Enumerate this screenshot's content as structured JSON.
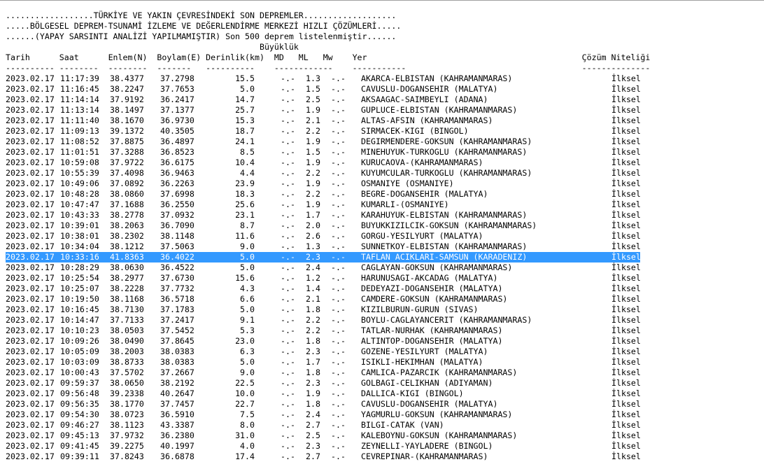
{
  "header": {
    "line1": "..................TÜRKİYE VE YAKIN ÇEVRESİNDEKİ SON DEPREMLER...................",
    "line2": ".....BÖLGESEL DEPREM-TSUNAMİ İZLEME VE DEĞERLENDİRME MERKEZİ HIZLI ÇÖZÜMLERİ.....",
    "line3": "......(YAPAY SARSINTI ANALİZİ YAPILMAMIŞTIR) Son 500 deprem listelenmiştir......",
    "line4": "                                                    Büyüklük",
    "line5": "Tarih      Saat      Enlem(N)  Boylam(E) Derinlik(km)  MD   ML   Mw    Yer                                            Çözüm Niteliği",
    "line6": "---------- --------  --------  -------   ----------    ------------    -----------                                    --------------"
  },
  "selected_index": 17,
  "rows": [
    {
      "date": "2023.02.17",
      "time": "11:17:39",
      "lat": "38.4377",
      "lon": "37.2798",
      "depth": "15.5",
      "md": "-.-",
      "ml": "1.3",
      "mw": "-.-",
      "location": "AKARCA-ELBISTAN (KAHRAMANMARAS)",
      "quality": "İlksel"
    },
    {
      "date": "2023.02.17",
      "time": "11:16:45",
      "lat": "38.2247",
      "lon": "37.7653",
      "depth": "5.0",
      "md": "-.-",
      "ml": "1.5",
      "mw": "-.-",
      "location": "CAVUSLU-DOGANSEHIR (MALATYA)",
      "quality": "İlksel"
    },
    {
      "date": "2023.02.17",
      "time": "11:14:14",
      "lat": "37.9192",
      "lon": "36.2417",
      "depth": "14.7",
      "md": "-.-",
      "ml": "2.5",
      "mw": "-.-",
      "location": "AKSAAGAC-SAIMBEYLI (ADANA)",
      "quality": "İlksel"
    },
    {
      "date": "2023.02.17",
      "time": "11:13:14",
      "lat": "38.1497",
      "lon": "37.1377",
      "depth": "25.7",
      "md": "-.-",
      "ml": "1.9",
      "mw": "-.-",
      "location": "GUPLUCE-ELBISTAN (KAHRAMANMARAS)",
      "quality": "İlksel"
    },
    {
      "date": "2023.02.17",
      "time": "11:11:40",
      "lat": "38.1670",
      "lon": "36.9730",
      "depth": "15.3",
      "md": "-.-",
      "ml": "2.1",
      "mw": "-.-",
      "location": "ALTAS-AFSIN (KAHRAMANMARAS)",
      "quality": "İlksel"
    },
    {
      "date": "2023.02.17",
      "time": "11:09:13",
      "lat": "39.1372",
      "lon": "40.3505",
      "depth": "18.7",
      "md": "-.-",
      "ml": "2.2",
      "mw": "-.-",
      "location": "SIRMACEK-KIGI (BINGOL)",
      "quality": "İlksel"
    },
    {
      "date": "2023.02.17",
      "time": "11:08:52",
      "lat": "37.8875",
      "lon": "36.4897",
      "depth": "24.1",
      "md": "-.-",
      "ml": "1.9",
      "mw": "-.-",
      "location": "DEGIRMENDERE-GOKSUN (KAHRAMANMARAS)",
      "quality": "İlksel"
    },
    {
      "date": "2023.02.17",
      "time": "11:01:51",
      "lat": "37.3288",
      "lon": "36.8523",
      "depth": "8.5",
      "md": "-.-",
      "ml": "1.5",
      "mw": "-.-",
      "location": "MINEHUYUK-TURKOGLU (KAHRAMANMARAS)",
      "quality": "İlksel"
    },
    {
      "date": "2023.02.17",
      "time": "10:59:08",
      "lat": "37.9722",
      "lon": "36.6175",
      "depth": "10.4",
      "md": "-.-",
      "ml": "1.9",
      "mw": "-.-",
      "location": "KURUCAOVA-(KAHRAMANMARAS)",
      "quality": "İlksel"
    },
    {
      "date": "2023.02.17",
      "time": "10:55:39",
      "lat": "37.4098",
      "lon": "36.9463",
      "depth": "4.4",
      "md": "-.-",
      "ml": "2.2",
      "mw": "-.-",
      "location": "KUYUMCULAR-TURKOGLU (KAHRAMANMARAS)",
      "quality": "İlksel"
    },
    {
      "date": "2023.02.17",
      "time": "10:49:06",
      "lat": "37.0892",
      "lon": "36.2263",
      "depth": "23.9",
      "md": "-.-",
      "ml": "1.9",
      "mw": "-.-",
      "location": "OSMANIYE (OSMANIYE)",
      "quality": "İlksel"
    },
    {
      "date": "2023.02.17",
      "time": "10:48:28",
      "lat": "38.0860",
      "lon": "37.6998",
      "depth": "18.3",
      "md": "-.-",
      "ml": "2.2",
      "mw": "-.-",
      "location": "BEGRE-DOGANSEHIR (MALATYA)",
      "quality": "İlksel"
    },
    {
      "date": "2023.02.17",
      "time": "10:47:47",
      "lat": "37.1688",
      "lon": "36.2550",
      "depth": "25.6",
      "md": "-.-",
      "ml": "1.9",
      "mw": "-.-",
      "location": "KUMARLI-(OSMANIYE)",
      "quality": "İlksel"
    },
    {
      "date": "2023.02.17",
      "time": "10:43:33",
      "lat": "38.2778",
      "lon": "37.0932",
      "depth": "23.1",
      "md": "-.-",
      "ml": "1.7",
      "mw": "-.-",
      "location": "KARAHUYUK-ELBISTAN (KAHRAMANMARAS)",
      "quality": "İlksel"
    },
    {
      "date": "2023.02.17",
      "time": "10:39:01",
      "lat": "38.2063",
      "lon": "36.7090",
      "depth": "8.7",
      "md": "-.-",
      "ml": "2.0",
      "mw": "-.-",
      "location": "BUYUKKIZILCIK-GOKSUN (KAHRAMANMARAS)",
      "quality": "İlksel"
    },
    {
      "date": "2023.02.17",
      "time": "10:38:01",
      "lat": "38.2302",
      "lon": "38.1148",
      "depth": "11.6",
      "md": "-.-",
      "ml": "2.6",
      "mw": "-.-",
      "location": "GORGU-YESILYURT (MALATYA)",
      "quality": "İlksel"
    },
    {
      "date": "2023.02.17",
      "time": "10:34:04",
      "lat": "38.1212",
      "lon": "37.5063",
      "depth": "9.0",
      "md": "-.-",
      "ml": "1.3",
      "mw": "-.-",
      "location": "SUNNETKOY-ELBISTAN (KAHRAMANMARAS)",
      "quality": "İlksel"
    },
    {
      "date": "2023.02.17",
      "time": "10:33:16",
      "lat": "41.8363",
      "lon": "36.4022",
      "depth": "5.0",
      "md": "-.-",
      "ml": "2.3",
      "mw": "-.-",
      "location": "TAFLAN ACIKLARI-SAMSUN (KARADENIZ)",
      "quality": "İlksel"
    },
    {
      "date": "2023.02.17",
      "time": "10:28:29",
      "lat": "38.0630",
      "lon": "36.4522",
      "depth": "5.0",
      "md": "-.-",
      "ml": "2.4",
      "mw": "-.-",
      "location": "CAGLAYAN-GOKSUN (KAHRAMANMARAS)",
      "quality": "İlksel"
    },
    {
      "date": "2023.02.17",
      "time": "10:25:54",
      "lat": "38.2977",
      "lon": "37.6730",
      "depth": "15.6",
      "md": "-.-",
      "ml": "1.2",
      "mw": "-.-",
      "location": "HARUNUSAGI-AKCADAG (MALATYA)",
      "quality": "İlksel"
    },
    {
      "date": "2023.02.17",
      "time": "10:25:07",
      "lat": "38.2228",
      "lon": "37.7732",
      "depth": "4.3",
      "md": "-.-",
      "ml": "1.4",
      "mw": "-.-",
      "location": "DEDEYAZI-DOGANSEHIR (MALATYA)",
      "quality": "İlksel"
    },
    {
      "date": "2023.02.17",
      "time": "10:19:50",
      "lat": "38.1168",
      "lon": "36.5718",
      "depth": "6.6",
      "md": "-.-",
      "ml": "2.1",
      "mw": "-.-",
      "location": "CAMDERE-GOKSUN (KAHRAMANMARAS)",
      "quality": "İlksel"
    },
    {
      "date": "2023.02.17",
      "time": "10:16:45",
      "lat": "38.7130",
      "lon": "37.1783",
      "depth": "5.0",
      "md": "-.-",
      "ml": "1.8",
      "mw": "-.-",
      "location": "KIZILBURUN-GURUN (SIVAS)",
      "quality": "İlksel"
    },
    {
      "date": "2023.02.17",
      "time": "10:14:47",
      "lat": "37.7133",
      "lon": "37.2417",
      "depth": "9.1",
      "md": "-.-",
      "ml": "2.2",
      "mw": "-.-",
      "location": "BOYLU-CAGLAYANCERIT (KAHRAMANMARAS)",
      "quality": "İlksel"
    },
    {
      "date": "2023.02.17",
      "time": "10:10:23",
      "lat": "38.0503",
      "lon": "37.5452",
      "depth": "5.3",
      "md": "-.-",
      "ml": "2.2",
      "mw": "-.-",
      "location": "TATLAR-NURHAK (KAHRAMANMARAS)",
      "quality": "İlksel"
    },
    {
      "date": "2023.02.17",
      "time": "10:09:26",
      "lat": "38.0490",
      "lon": "37.8645",
      "depth": "23.0",
      "md": "-.-",
      "ml": "1.8",
      "mw": "-.-",
      "location": "ALTINTOP-DOGANSEHIR (MALATYA)",
      "quality": "İlksel"
    },
    {
      "date": "2023.02.17",
      "time": "10:05:09",
      "lat": "38.2003",
      "lon": "38.0383",
      "depth": "6.3",
      "md": "-.-",
      "ml": "2.3",
      "mw": "-.-",
      "location": "GOZENE-YESILYURT (MALATYA)",
      "quality": "İlksel"
    },
    {
      "date": "2023.02.17",
      "time": "10:03:09",
      "lat": "38.8733",
      "lon": "38.0383",
      "depth": "5.0",
      "md": "-.-",
      "ml": "1.7",
      "mw": "-.-",
      "location": "ISIKLI-HEKIMHAN (MALATYA)",
      "quality": "İlksel"
    },
    {
      "date": "2023.02.17",
      "time": "10:00:43",
      "lat": "37.5702",
      "lon": "37.2667",
      "depth": "9.0",
      "md": "-.-",
      "ml": "1.8",
      "mw": "-.-",
      "location": "CAMLICA-PAZARCIK (KAHRAMANMARAS)",
      "quality": "İlksel"
    },
    {
      "date": "2023.02.17",
      "time": "09:59:37",
      "lat": "38.0650",
      "lon": "38.2192",
      "depth": "22.5",
      "md": "-.-",
      "ml": "2.3",
      "mw": "-.-",
      "location": "GOLBAGI-CELIKHAN (ADIYAMAN)",
      "quality": "İlksel"
    },
    {
      "date": "2023.02.17",
      "time": "09:56:48",
      "lat": "39.2338",
      "lon": "40.2647",
      "depth": "10.0",
      "md": "-.-",
      "ml": "1.9",
      "mw": "-.-",
      "location": "DALLICA-KIGI (BINGOL)",
      "quality": "İlksel"
    },
    {
      "date": "2023.02.17",
      "time": "09:56:35",
      "lat": "38.1770",
      "lon": "37.7457",
      "depth": "22.7",
      "md": "-.-",
      "ml": "1.8",
      "mw": "-.-",
      "location": "CAVUSLU-DOGANSEHIR (MALATYA)",
      "quality": "İlksel"
    },
    {
      "date": "2023.02.17",
      "time": "09:54:30",
      "lat": "38.0723",
      "lon": "36.5910",
      "depth": "7.5",
      "md": "-.-",
      "ml": "2.4",
      "mw": "-.-",
      "location": "YAGMURLU-GOKSUN (KAHRAMANMARAS)",
      "quality": "İlksel"
    },
    {
      "date": "2023.02.17",
      "time": "09:46:27",
      "lat": "38.1123",
      "lon": "43.3387",
      "depth": "8.0",
      "md": "-.-",
      "ml": "2.7",
      "mw": "-.-",
      "location": "BILGI-CATAK (VAN)",
      "quality": "İlksel"
    },
    {
      "date": "2023.02.17",
      "time": "09:45:13",
      "lat": "37.9732",
      "lon": "36.2380",
      "depth": "31.0",
      "md": "-.-",
      "ml": "2.5",
      "mw": "-.-",
      "location": "KALEBOYNU-GOKSUN (KAHRAMANMARAS)",
      "quality": "İlksel"
    },
    {
      "date": "2023.02.17",
      "time": "09:41:45",
      "lat": "39.2275",
      "lon": "40.1997",
      "depth": "4.0",
      "md": "-.-",
      "ml": "2.3",
      "mw": "-.-",
      "location": "ZEYNELLI-YAYLADERE (BINGOL)",
      "quality": "İlksel"
    },
    {
      "date": "2023.02.17",
      "time": "09:39:11",
      "lat": "37.8243",
      "lon": "36.6878",
      "depth": "17.4",
      "md": "-.-",
      "ml": "2.7",
      "mw": "-.-",
      "location": "CEVREPINAR-(KAHRAMANMARAS)",
      "quality": "İlksel"
    }
  ]
}
